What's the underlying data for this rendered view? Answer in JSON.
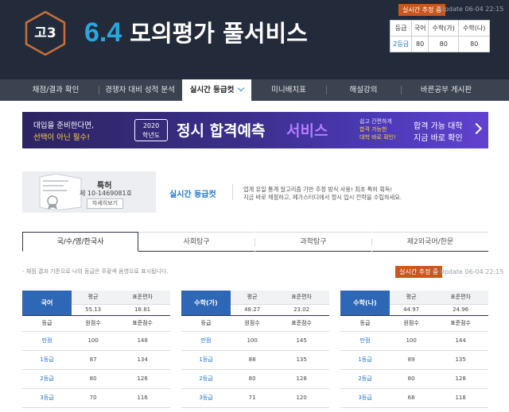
{
  "header": {
    "grade_badge": "고3",
    "title_number": "6.4",
    "title_text": "모의평가 풀서비스",
    "live_tag": "실시간 추정 중",
    "update_text": "Update 06-04 22:15",
    "mini_table": {
      "headers": [
        "등급",
        "국어",
        "수학(가)",
        "수학(나)"
      ],
      "row": [
        "2등급",
        "80",
        "80",
        "80"
      ]
    }
  },
  "nav": {
    "items": [
      "채점/결과 확인",
      "경쟁자 대비 성적 분석",
      "실시간 등급컷",
      "미니배치표",
      "해설강의",
      "바른공부 게시판"
    ]
  },
  "banner": {
    "line1": "대입을 준비한다면,",
    "line2": "선택이 아닌 필수!",
    "year": "2020",
    "year_sub": "학년도",
    "headline": "정시 합격예측",
    "headline_accent": "서비스",
    "small1": "쉽고 간편하게",
    "small2": "합격 가능한",
    "small3": "대학 바로 확인!",
    "right1": "합격 가능 대학",
    "right2": "지금 바로 확인"
  },
  "patent": {
    "title": "특허",
    "number": "제 10-1469081호",
    "button": "자세히보기",
    "label": "실시간 등급컷",
    "desc1": "업계 유일 통계 알고리즘 기반 추정 방식 사용! 최초 특허 획득!",
    "desc2": "지금 바로 채점하고, 메가스터디에서 정시 입시 전략을 수립하세요."
  },
  "tabs": [
    "국/수/영/한국사",
    "사회탐구",
    "과학탐구",
    "제2외국어/한문"
  ],
  "note": "- 채점 결과 기준으로 나의 등급은 주황색 음영으로 표시됩니다.",
  "live_tag_mid": "실시간 추정 중",
  "update_mid": "Update 06-04 22:15",
  "score_tables": [
    {
      "subject": "국어",
      "labels": {
        "avg": "평균",
        "sd": "표준편차",
        "grade": "등급",
        "raw": "원점수",
        "std": "표준점수"
      },
      "avg": "55.13",
      "sd": "18.81",
      "rows": [
        {
          "grade": "만점",
          "raw": "100",
          "std": "148"
        },
        {
          "grade": "1등급",
          "raw": "87",
          "std": "134"
        },
        {
          "grade": "2등급",
          "raw": "80",
          "std": "126"
        },
        {
          "grade": "3등급",
          "raw": "70",
          "std": "116"
        }
      ]
    },
    {
      "subject": "수학(가)",
      "labels": {
        "avg": "평균",
        "sd": "표준편차",
        "grade": "등급",
        "raw": "원점수",
        "std": "표준점수"
      },
      "avg": "48.27",
      "sd": "23.02",
      "rows": [
        {
          "grade": "만점",
          "raw": "100",
          "std": "145"
        },
        {
          "grade": "1등급",
          "raw": "88",
          "std": "135"
        },
        {
          "grade": "2등급",
          "raw": "80",
          "std": "128"
        },
        {
          "grade": "3등급",
          "raw": "71",
          "std": "120"
        }
      ]
    },
    {
      "subject": "수학(나)",
      "labels": {
        "avg": "평균",
        "sd": "표준편차",
        "grade": "등급",
        "raw": "원점수",
        "std": "표준점수"
      },
      "avg": "44.97",
      "sd": "24.96",
      "rows": [
        {
          "grade": "만점",
          "raw": "100",
          "std": "144"
        },
        {
          "grade": "1등급",
          "raw": "89",
          "std": "135"
        },
        {
          "grade": "2등급",
          "raw": "80",
          "std": "128"
        },
        {
          "grade": "3등급",
          "raw": "68",
          "std": "118"
        }
      ]
    }
  ]
}
